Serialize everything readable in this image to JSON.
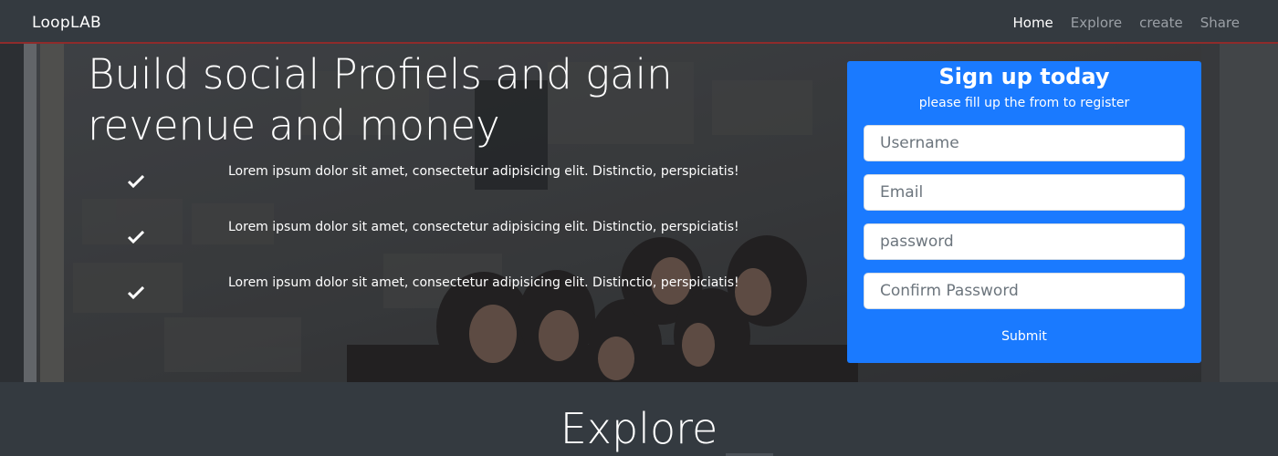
{
  "navbar": {
    "brand": "LoopLAB",
    "links": [
      {
        "label": "Home",
        "active": true
      },
      {
        "label": "Explore",
        "active": false
      },
      {
        "label": "create",
        "active": false
      },
      {
        "label": "Share",
        "active": false
      }
    ]
  },
  "hero": {
    "headline": "Build social Profiels and gain revenue and money",
    "features": [
      {
        "icon": "check-icon",
        "text": "Lorem ipsum dolor sit amet, consectetur adipisicing elit. Distinctio, perspiciatis!"
      },
      {
        "icon": "check-icon",
        "text": "Lorem ipsum dolor sit amet, consectetur adipisicing elit. Distinctio, perspiciatis!"
      },
      {
        "icon": "check-icon",
        "text": "Lorem ipsum dolor sit amet, consectetur adipisicing elit. Distinctio, perspiciatis!"
      }
    ]
  },
  "signup": {
    "title": "Sign up today",
    "subtitle": "please fill up the from to register",
    "fields": [
      {
        "placeholder": "Username",
        "value": ""
      },
      {
        "placeholder": "Email",
        "value": ""
      },
      {
        "placeholder": "password",
        "value": ""
      },
      {
        "placeholder": "Confirm Password",
        "value": ""
      }
    ],
    "submit_label": "Submit"
  },
  "explore": {
    "title": "Explore"
  },
  "colors": {
    "navbar_bg": "#343a40",
    "card_bg": "#1a7aff",
    "accent_border": "#8f2b2b"
  }
}
